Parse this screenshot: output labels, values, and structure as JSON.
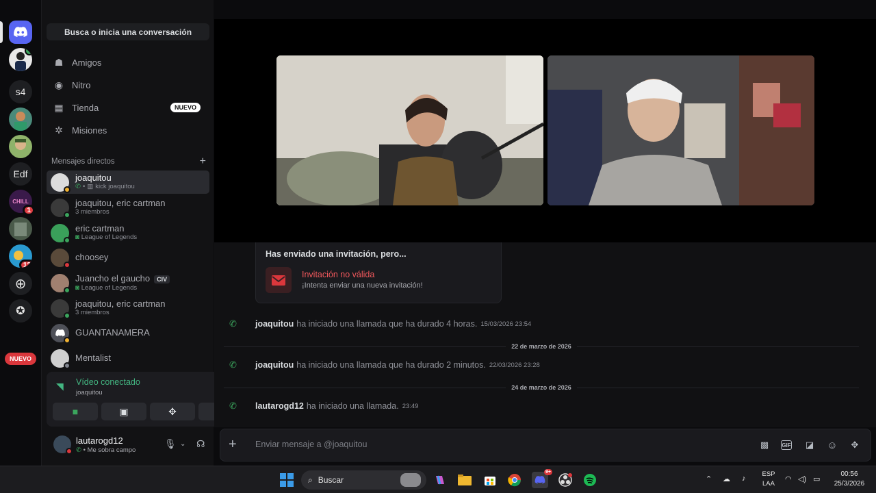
{
  "search": {
    "label": "Busca o inicia una conversación"
  },
  "nav": [
    {
      "label": "Amigos",
      "icon": "friends-icon"
    },
    {
      "label": "Nitro",
      "icon": "nitro-icon"
    },
    {
      "label": "Tienda",
      "icon": "shop-icon",
      "badge": "NUEVO"
    },
    {
      "label": "Misiones",
      "icon": "quests-icon"
    }
  ],
  "rail": {
    "servers": [
      "s4",
      "Edf"
    ],
    "badges": [
      "1",
      "12"
    ],
    "nuevo": "NUEVO"
  },
  "dm_header": {
    "title": "Mensajes directos",
    "add": "+"
  },
  "dms": [
    {
      "name": "joaquitou",
      "sub": "kick joaquitou"
    },
    {
      "name": "joaquitou, eric cartman",
      "sub": "3 miembros"
    },
    {
      "name": "eric cartman",
      "sub": "League of Legends"
    },
    {
      "name": "choosey",
      "sub": ""
    },
    {
      "name": "Juancho el gaucho",
      "sub": "League of Legends",
      "tag": "CIV"
    },
    {
      "name": "joaquitou, eric cartman",
      "sub": "3 miembros"
    },
    {
      "name": "GUANTANAMERA",
      "sub": ""
    },
    {
      "name": "Mentalist",
      "sub": ""
    }
  ],
  "voice": {
    "title": "Vídeo conectado",
    "channel": "joaquitou"
  },
  "user": {
    "name": "lautarogd12",
    "status": "Me sobra campo"
  },
  "invite": {
    "heading": "Has enviado una invitación, pero...",
    "title": "Invitación no válida",
    "subtitle": "¡Intenta enviar una nueva invitación!"
  },
  "messages": [
    {
      "who": "joaquitou",
      "text": "ha iniciado una llamada que ha durado 4 horas.",
      "ts": "15/03/2026 23:54"
    },
    {
      "who": "joaquitou",
      "text": "ha iniciado una llamada que ha durado 2 minutos.",
      "ts": "22/03/2026 23:28"
    },
    {
      "who": "lautarogd12",
      "text": "ha iniciado una llamada.",
      "ts": "23:49"
    }
  ],
  "separators": [
    "22 de marzo de 2026",
    "24 de marzo de 2026"
  ],
  "composer": {
    "placeholder": "Enviar mensaje a @joaquitou",
    "gif": "GIF"
  },
  "taskbar": {
    "search": "Buscar",
    "lang1": "ESP",
    "lang2": "LAA",
    "time": "00:56",
    "date": "25/3/2026",
    "discord_badge": "9+"
  },
  "colors": {
    "accent": "#5865f2",
    "online": "#3ba55d",
    "danger": "#da373c"
  }
}
